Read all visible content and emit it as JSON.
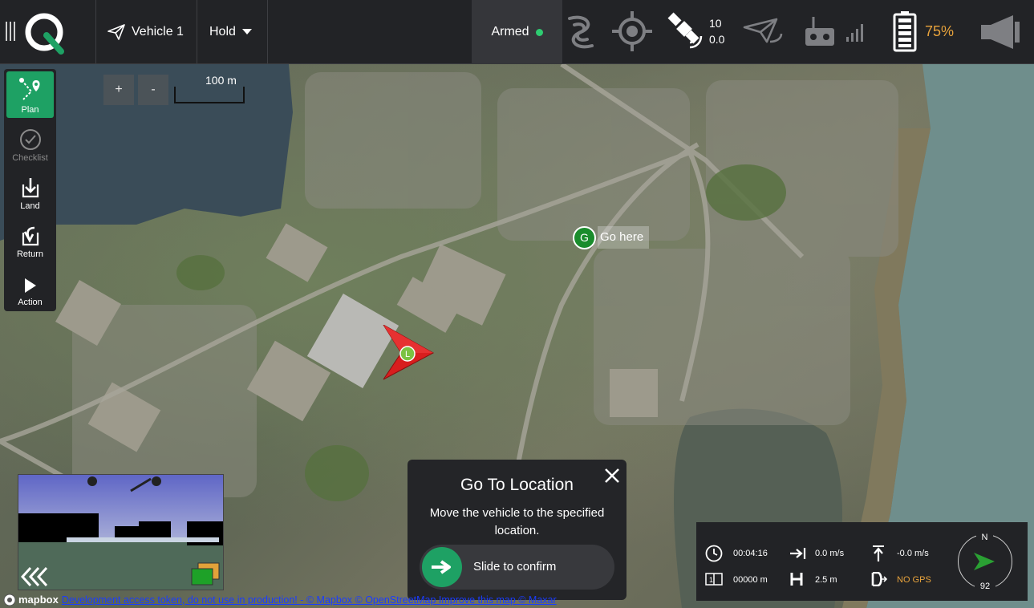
{
  "colors": {
    "toolbar_bg": "#222326",
    "accent_green": "#1ea164",
    "armed_dot": "#2ecc71",
    "battery_orange": "#e8a33c",
    "no_gps_orange": "#e8a33c",
    "vehicle_red": "#d81e1e"
  },
  "toolbar": {
    "menu_icon": "vertical-lines-icon",
    "logo_icon": "qgc-logo-icon",
    "vehicle_label": "Vehicle 1",
    "vehicle_icon": "paper-plane-icon",
    "mode_label": "Hold",
    "mode_icon": "caret-down-icon",
    "armed_label": "Armed",
    "gps_satellites": "10",
    "gps_hdop": "0.0",
    "battery_percent": "75%",
    "icons": [
      "signal-waves-icon",
      "target-icon",
      "satellite-icon",
      "telemetry-plane-icon",
      "rc-transmitter-icon",
      "signal-bars-icon",
      "battery-icon",
      "megaphone-icon"
    ]
  },
  "toolstrip": {
    "items": [
      {
        "label": "Plan",
        "icon": "plan-route-icon",
        "state": "active"
      },
      {
        "label": "Checklist",
        "icon": "checklist-icon",
        "state": "disabled"
      },
      {
        "label": "Land",
        "icon": "land-icon",
        "state": "normal"
      },
      {
        "label": "Return",
        "icon": "return-icon",
        "state": "normal"
      },
      {
        "label": "Action",
        "icon": "play-icon",
        "state": "normal"
      }
    ]
  },
  "map": {
    "zoom_in": "+",
    "zoom_out": "-",
    "scale_label": "100 m",
    "goto_marker_letter": "G",
    "goto_marker_label": "Go here",
    "vehicle_marker_letter": "L"
  },
  "dialog": {
    "title": "Go To Location",
    "description": "Move the vehicle to the specified location.",
    "slider_label": "Slide to confirm",
    "close_icon": "close-icon",
    "slider_icon": "arrow-right-icon"
  },
  "telemetry": {
    "flight_time": "00:04:16",
    "horizontal_speed": "0.0 m/s",
    "vertical_speed": "-0.0 m/s",
    "distance": "00000 m",
    "height": "2.5 m",
    "gps_status": "NO GPS",
    "compass_north": "N",
    "heading": "92"
  },
  "attribution": {
    "logo_text": "mapbox",
    "links": "Development access token, do not use in production! - © Mapbox © OpenStreetMap Improve this map © Maxar"
  }
}
